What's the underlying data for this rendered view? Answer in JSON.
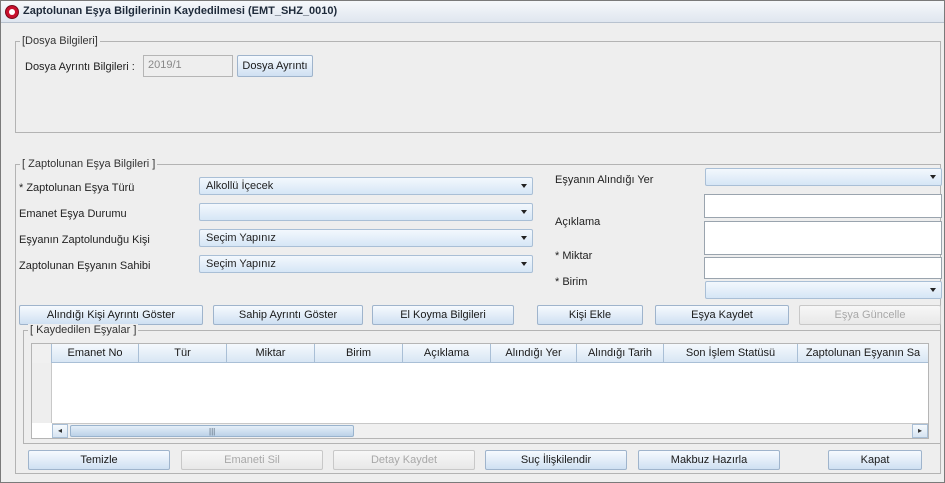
{
  "window": {
    "title": "Zaptolunan Eşya Bilgilerinin Kaydedilmesi (EMT_SHZ_0010)"
  },
  "dosya": {
    "group_title": "[Dosya Bilgileri]",
    "label": "Dosya Ayrıntı Bilgileri :",
    "value": "2019/1",
    "button": "Dosya Ayrıntı"
  },
  "esya": {
    "group_title": "[ Zaptolunan Eşya Bilgileri ]",
    "tur_label": "* Zaptolunan Eşya Türü",
    "tur_value": "Alkollü İçecek",
    "durum_label": "Emanet Eşya Durumu",
    "durum_value": "",
    "kisi_label": "Eşyanın Zaptolunduğu Kişi",
    "kisi_value": "Seçim Yapınız",
    "sahip_label": "Zaptolunan Eşyanın Sahibi",
    "sahip_value": "Seçim Yapınız",
    "yer_label": "Eşyanın Alındığı Yer",
    "yer_value": "",
    "aciklama_label": "Açıklama",
    "aciklama_value": "",
    "miktar_label": "* Miktar",
    "miktar_value": "",
    "birim_label": "* Birim",
    "birim_value": ""
  },
  "actions": {
    "alindigi_kisi": "Alındığı Kişi Ayrıntı Göster",
    "sahip_ayrinti": "Sahip Ayrıntı Göster",
    "el_koyma": "El Koyma Bilgileri",
    "kisi_ekle": "Kişi Ekle",
    "esya_kaydet": "Eşya Kaydet",
    "esya_guncelle": "Eşya Güncelle"
  },
  "kaydedilen": {
    "group_title": "[ Kaydedilen Eşyalar ]",
    "columns": [
      "Emanet No",
      "Tür",
      "Miktar",
      "Birim",
      "Açıklama",
      "Alındığı Yer",
      "Alındığı Tarih",
      "Son İşlem Statüsü",
      "Zaptolunan Eşyanın Sa"
    ],
    "scroll_grip": "|||"
  },
  "footer": {
    "temizle": "Temizle",
    "emaneti_sil": "Emaneti Sil",
    "detay_kaydet": "Detay Kaydet",
    "suc_iliskilendir": "Suç İlişkilendir",
    "makbuz_hazirla": "Makbuz Hazırla",
    "kapat": "Kapat"
  }
}
